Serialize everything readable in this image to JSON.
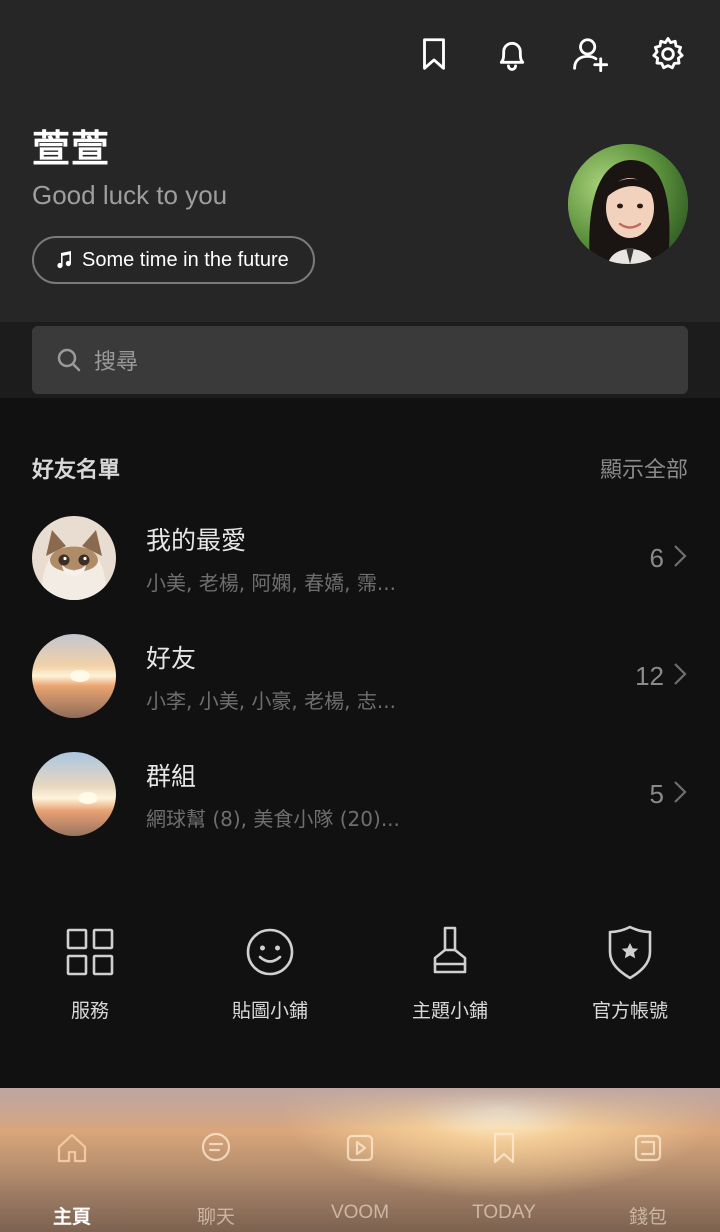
{
  "header": {
    "icons": [
      "bookmark-icon",
      "bell-icon",
      "add-friend-icon",
      "settings-gear-icon"
    ]
  },
  "profile": {
    "name": "萱萱",
    "status_message": "Good luck to you",
    "music": "Some time in the future"
  },
  "search": {
    "placeholder": "搜尋"
  },
  "friends_section": {
    "title": "好友名單",
    "show_all": "顯示全部",
    "rows": [
      {
        "title": "我的最愛",
        "subtitle": "小美, 老楊, 阿嫻, 春嬌, 霈...",
        "count": "6"
      },
      {
        "title": "好友",
        "subtitle": "小李, 小美, 小豪, 老楊, 志...",
        "count": "12"
      },
      {
        "title": "群組",
        "subtitle": "網球幫 (8), 美食小隊 (20)...",
        "count": "5"
      }
    ]
  },
  "services": [
    {
      "label": "服務",
      "icon": "grid-icon"
    },
    {
      "label": "貼圖小鋪",
      "icon": "smiley-icon"
    },
    {
      "label": "主題小鋪",
      "icon": "brush-icon"
    },
    {
      "label": "官方帳號",
      "icon": "shield-star-icon"
    }
  ],
  "tabbar": {
    "active": "主頁",
    "tabs": [
      {
        "label": "主頁",
        "icon": "home-icon"
      },
      {
        "label": "聊天",
        "icon": "chat-icon"
      },
      {
        "label": "VOOM",
        "icon": "video-icon"
      },
      {
        "label": "TODAY",
        "icon": "today-bookmark-icon"
      },
      {
        "label": "錢包",
        "icon": "wallet-icon"
      }
    ]
  },
  "colors": {
    "header_bg": "#262626",
    "body_bg": "#111111",
    "search_bg": "#3a3a3a"
  }
}
